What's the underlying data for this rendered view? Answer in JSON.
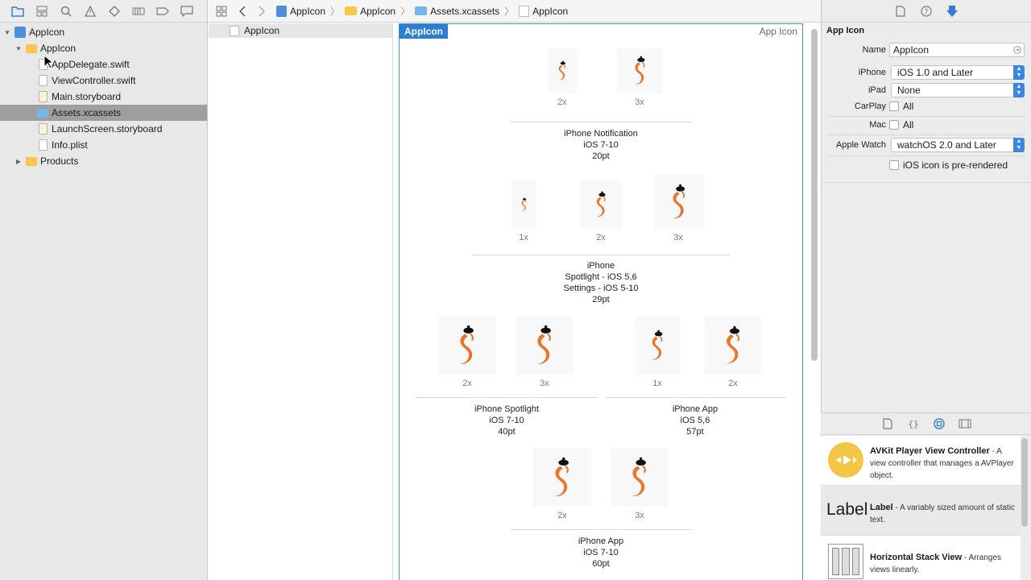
{
  "navigator": {
    "tree": [
      {
        "label": "AppIcon",
        "kind": "project",
        "expanded": true
      },
      {
        "label": "AppIcon",
        "kind": "folder",
        "expanded": true
      },
      {
        "label": "AppDelegate.swift",
        "kind": "swift"
      },
      {
        "label": "ViewController.swift",
        "kind": "swift"
      },
      {
        "label": "Main.storyboard",
        "kind": "storyboard"
      },
      {
        "label": "Assets.xcassets",
        "kind": "assets",
        "selected": true
      },
      {
        "label": "LaunchScreen.storyboard",
        "kind": "storyboard"
      },
      {
        "label": "Info.plist",
        "kind": "plist"
      },
      {
        "label": "Products",
        "kind": "folder",
        "expanded": false
      }
    ]
  },
  "pathbar": {
    "crumbs": [
      "AppIcon",
      "AppIcon",
      "Assets.xcassets",
      "AppIcon"
    ]
  },
  "asset_list": {
    "items": [
      "AppIcon"
    ]
  },
  "editor": {
    "set_name": "AppIcon",
    "set_kind": "App Icon",
    "groups": [
      {
        "title": "iPhone Notification",
        "lines": [
          "iOS 7-10",
          "20pt"
        ],
        "scales": [
          "2x",
          "3x"
        ]
      },
      {
        "title": "iPhone",
        "lines": [
          "Spotlight - iOS 5,6",
          "Settings - iOS 5-10",
          "29pt"
        ],
        "scales": [
          "1x",
          "2x",
          "3x"
        ]
      },
      {
        "title": "iPhone Spotlight",
        "lines": [
          "iOS 7-10",
          "40pt"
        ],
        "scales": [
          "2x",
          "3x"
        ]
      },
      {
        "title": "iPhone App",
        "lines": [
          "iOS 5,6",
          "57pt"
        ],
        "scales": [
          "1x",
          "2x"
        ]
      },
      {
        "title": "iPhone App",
        "lines": [
          "iOS 7-10",
          "60pt"
        ],
        "scales": [
          "2x",
          "3x"
        ]
      }
    ]
  },
  "inspector": {
    "section_title": "App Icon",
    "name_label": "Name",
    "name_value": "AppIcon",
    "iphone_label": "iPhone",
    "iphone_value": "iOS 1.0 and Later",
    "ipad_label": "iPad",
    "ipad_value": "None",
    "carplay_label": "CarPlay",
    "carplay_value": "All",
    "mac_label": "Mac",
    "mac_value": "All",
    "watch_label": "Apple Watch",
    "watch_value": "watchOS 2.0 and Later",
    "prerendered_label": "iOS icon is pre-rendered"
  },
  "library": {
    "items": [
      {
        "title": "AVKit Player View Controller",
        "desc": " - A view controller that manages a AVPlayer object."
      },
      {
        "title": "Label",
        "desc": " - A variably sized amount of static text.",
        "thumb": "Label"
      },
      {
        "title": "Horizontal Stack View",
        "desc": " - Arranges views linearly."
      }
    ]
  },
  "colors": {
    "accent": "#2b7fd1",
    "icon_orange": "#e8762c",
    "selection": "#9e9e9e"
  }
}
